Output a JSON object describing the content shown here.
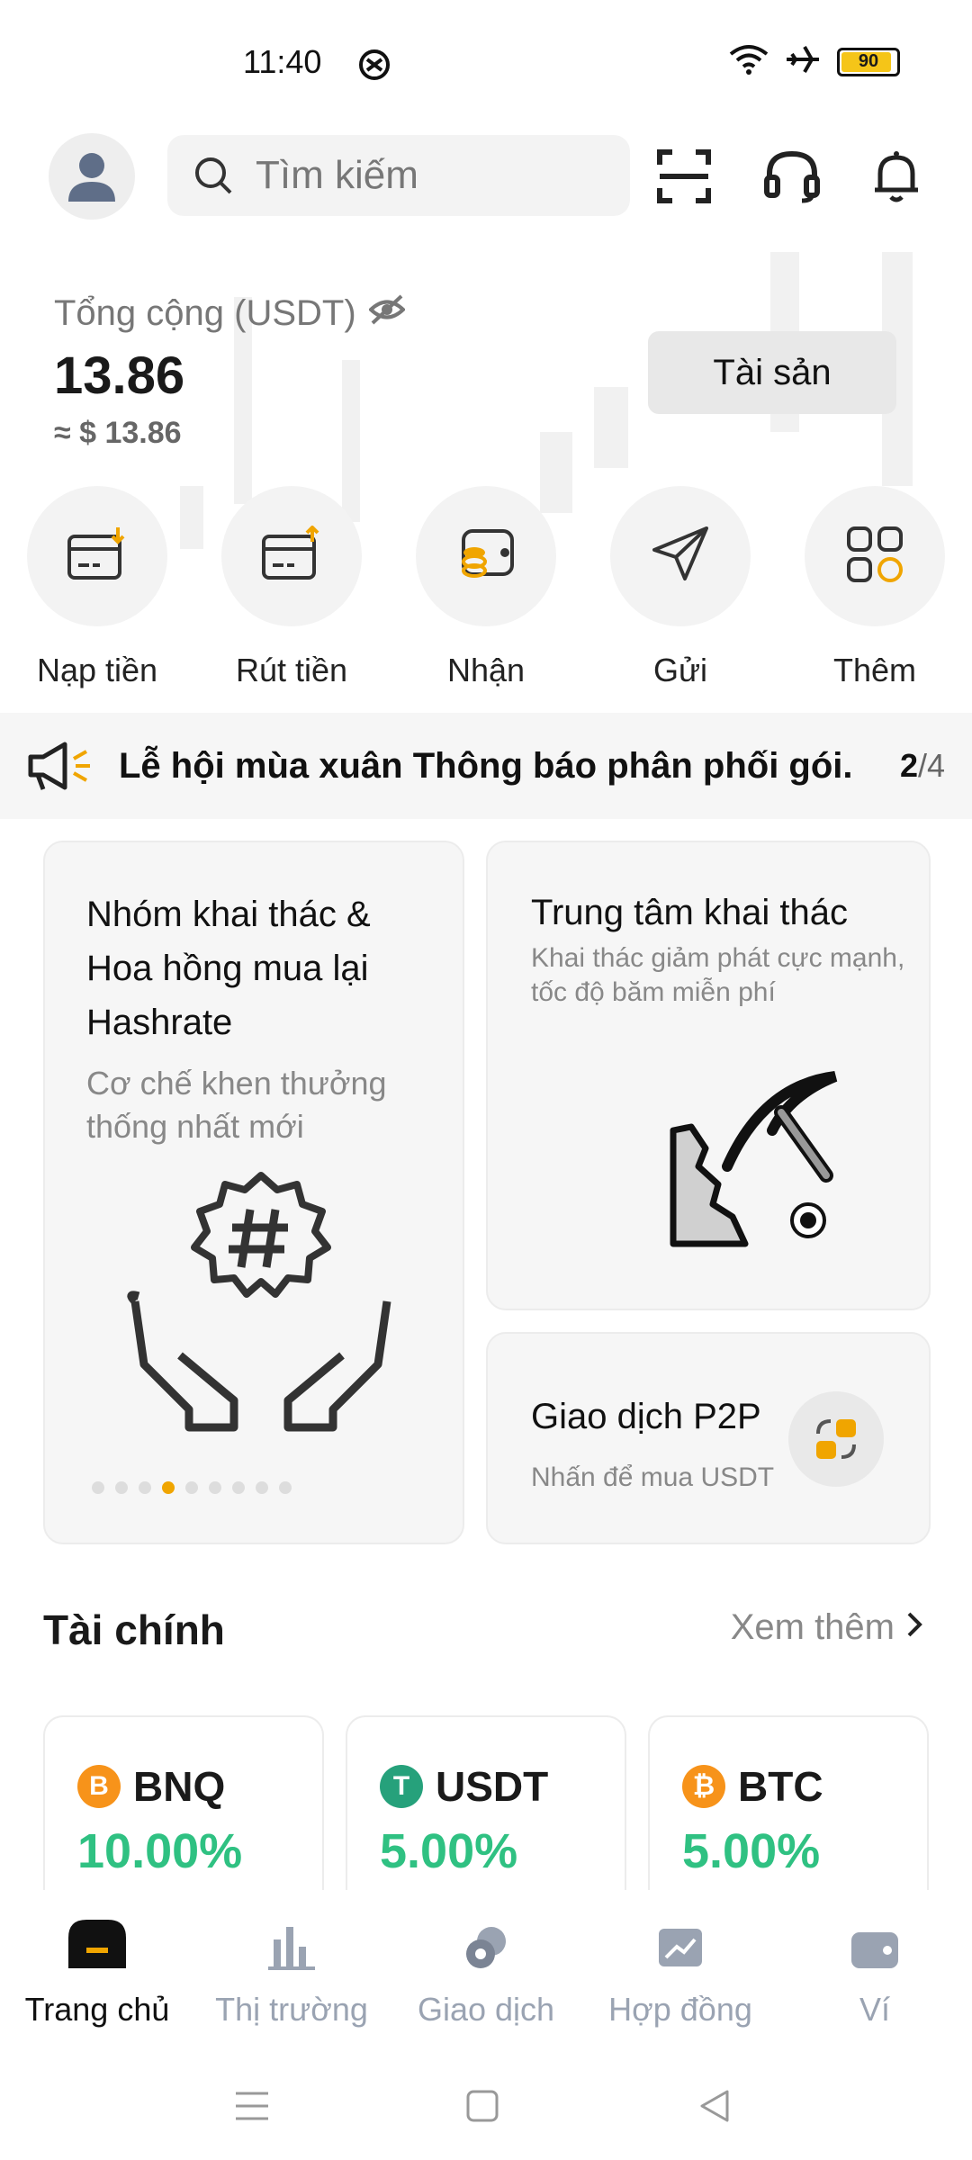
{
  "status_bar": {
    "time": "11:40",
    "battery": "90"
  },
  "search": {
    "placeholder": "Tìm kiếm"
  },
  "balance": {
    "label": "Tổng cộng (USDT)",
    "value": "13.86",
    "usd": "≈ $ 13.86",
    "assets_button": "Tài sản"
  },
  "actions": [
    {
      "label": "Nạp tiền"
    },
    {
      "label": "Rút tiền"
    },
    {
      "label": "Nhận"
    },
    {
      "label": "Gửi"
    },
    {
      "label": "Thêm"
    }
  ],
  "announcement": {
    "text": "Lễ hội mùa xuân Thông báo phân phối gói.",
    "page": "2",
    "total": "/4"
  },
  "cards": {
    "mining_pool": {
      "title": "Nhóm khai thác & Hoa hồng mua lại Hashrate",
      "subtitle": "Cơ chế khen thưởng thống nhất mới",
      "dot_count": 9,
      "active_dot": 4
    },
    "mining_center": {
      "title": "Trung tâm khai thác",
      "subtitle": "Khai thác giảm phát cực mạnh, tốc độ băm miễn phí"
    },
    "p2p": {
      "title": "Giao dịch P2P",
      "subtitle": "Nhấn để mua USDT"
    }
  },
  "finance": {
    "title": "Tài chính",
    "more": "Xem thêm",
    "items": [
      {
        "coin": "BNQ",
        "rate": "10.00%",
        "color": "#f7931a"
      },
      {
        "coin": "USDT",
        "rate": "5.00%",
        "color": "#26a17b"
      },
      {
        "coin": "BTC",
        "rate": "5.00%",
        "color": "#f7931a"
      }
    ]
  },
  "nav": [
    {
      "label": "Trang chủ",
      "active": true
    },
    {
      "label": "Thị trường",
      "active": false
    },
    {
      "label": "Giao dịch",
      "active": false
    },
    {
      "label": "Hợp đồng",
      "active": false
    },
    {
      "label": "Ví",
      "active": false
    }
  ],
  "colors": {
    "accent": "#f0a500",
    "positive": "#2fc182",
    "muted": "#9aa3b2"
  }
}
